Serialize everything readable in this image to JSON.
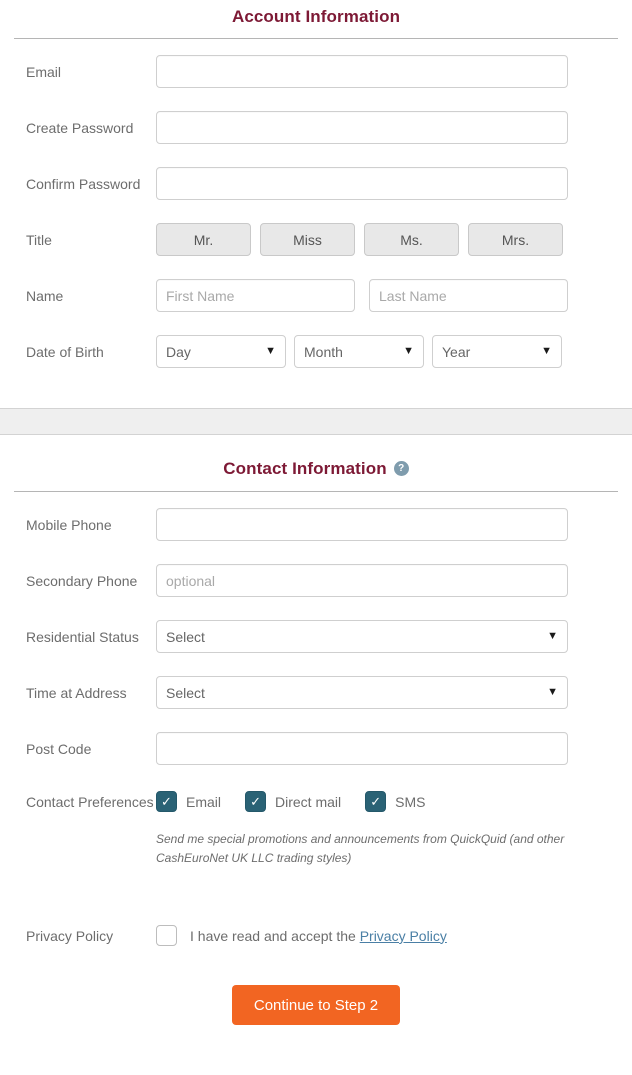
{
  "colors": {
    "heading": "#7d1935",
    "label": "#6d6d6d",
    "checkbox_checked": "#2a6275",
    "submit": "#f26522",
    "link": "#4a7fa5",
    "band": "#efefef",
    "help_icon": "#7f9cad"
  },
  "account_section": {
    "title": "Account Information",
    "rows": {
      "email": {
        "label": "Email",
        "value": "",
        "placeholder": ""
      },
      "create_password": {
        "label": "Create Password",
        "value": "",
        "placeholder": ""
      },
      "confirm_password": {
        "label": "Confirm Password",
        "value": "",
        "placeholder": ""
      },
      "title": {
        "label": "Title",
        "options": [
          "Mr.",
          "Miss",
          "Ms.",
          "Mrs."
        ],
        "selected": ""
      },
      "name": {
        "label": "Name",
        "first_placeholder": "First Name",
        "last_placeholder": "Last Name",
        "first_value": "",
        "last_value": ""
      },
      "date_of_birth": {
        "label": "Date of Birth",
        "day": "Day",
        "month": "Month",
        "year": "Year"
      }
    }
  },
  "contact_section": {
    "title": "Contact Information",
    "help_icon": "question-mark-icon",
    "help_icon_glyph": "?",
    "rows": {
      "mobile_phone": {
        "label": "Mobile Phone",
        "value": "",
        "placeholder": ""
      },
      "secondary_phone": {
        "label": "Secondary Phone",
        "value": "",
        "placeholder": "optional"
      },
      "residential_status": {
        "label": "Residential Status",
        "selected": "Select"
      },
      "time_at_address": {
        "label": "Time at Address",
        "selected": "Select"
      },
      "post_code": {
        "label": "Post Code",
        "value": "",
        "placeholder": ""
      },
      "contact_preferences": {
        "label": "Contact Preferences",
        "options": [
          {
            "label": "Email",
            "checked": true
          },
          {
            "label": "Direct mail",
            "checked": true
          },
          {
            "label": "SMS",
            "checked": true
          }
        ],
        "checkmark_glyph": "✓",
        "note": "Send me special promotions and announcements from QuickQuid (and other CashEuroNet UK LLC trading styles)"
      },
      "privacy_policy": {
        "label": "Privacy Policy",
        "checked": false,
        "accept_text": "I have read and accept the ",
        "link_text": "Privacy Policy"
      }
    }
  },
  "submit": {
    "label": "Continue to Step 2"
  }
}
